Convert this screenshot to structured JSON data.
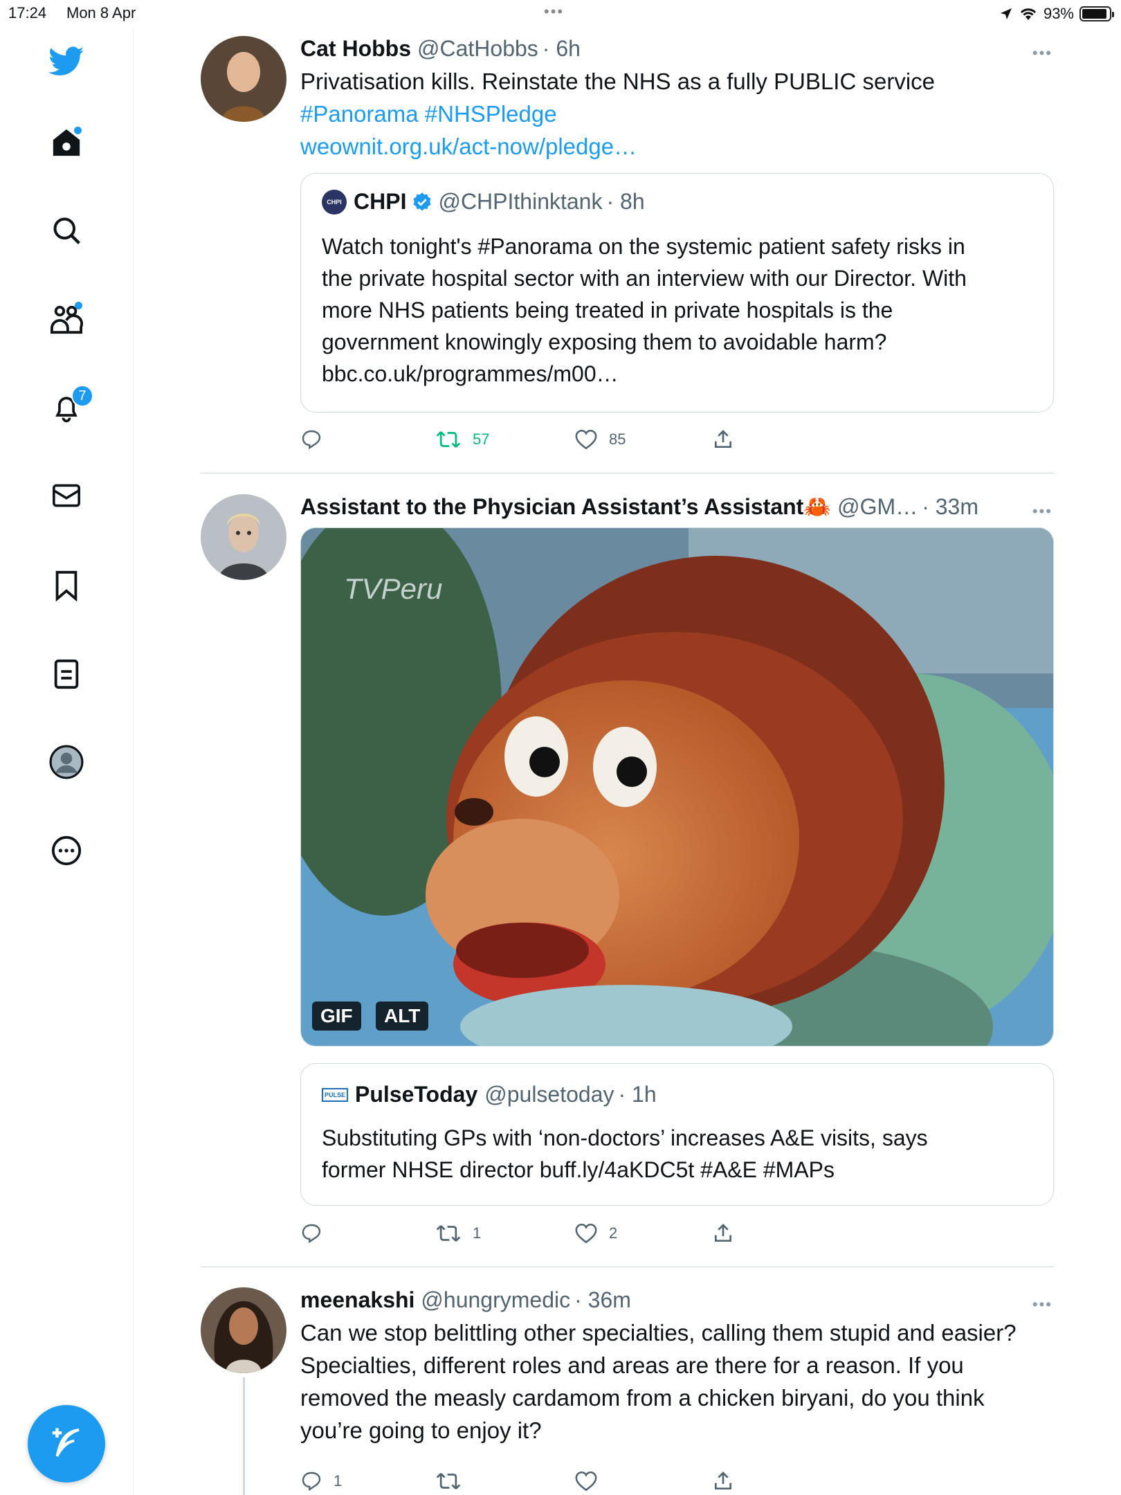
{
  "status_bar": {
    "time": "17:24",
    "date": "Mon 8 Apr",
    "battery": "93%",
    "battery_level": 0.93
  },
  "sidebar": {
    "items": [
      {
        "name": "twitter-logo"
      },
      {
        "name": "home",
        "has_dot": true
      },
      {
        "name": "explore"
      },
      {
        "name": "communities",
        "has_dot": true
      },
      {
        "name": "notifications",
        "badge": "7"
      },
      {
        "name": "messages"
      },
      {
        "name": "bookmarks"
      },
      {
        "name": "lists"
      },
      {
        "name": "profile"
      },
      {
        "name": "more"
      }
    ],
    "compose_icon": "feather-plus-icon"
  },
  "tweets": [
    {
      "name": "Cat Hobbs",
      "handle": "@CatHobbs",
      "time": "· 6h",
      "text": "Privatisation kills. Reinstate the NHS as a fully PUBLIC service",
      "hashtags": "#Panorama #NHSPledge",
      "link": "weownit.org.uk/act-now/pledge…",
      "quote": {
        "avatar_label": "CHPI",
        "name": "CHPI",
        "handle": "@CHPIthinktank",
        "time": "· 8h",
        "lines": [
          "Watch tonight's #Panorama on the systemic patient safety risks in",
          "the private hospital sector with an interview with our Director. With",
          "more NHS patients being treated in private hospitals is the",
          "government knowingly exposing them to avoidable harm?",
          "bbc.co.uk/programmes/m00…"
        ]
      },
      "actions": {
        "replies": "",
        "retweets": "57",
        "likes": "85"
      }
    },
    {
      "name": "Assistant to the Physician Assistant’s Assistant🦀",
      "handle": "@GM…",
      "time": "· 33m",
      "media": {
        "watermark": "TVPeru",
        "gif_label": "GIF",
        "alt_label": "ALT"
      },
      "quote": {
        "avatar_label": "PULSE",
        "name": "PulseToday",
        "handle": "@pulsetoday",
        "time": "· 1h",
        "lines": [
          "Substituting GPs with ‘non-doctors’ increases A&E visits, says",
          "former NHSE director buff.ly/4aKDC5t #A&E #MAPs"
        ]
      },
      "actions": {
        "replies": "",
        "retweets": "1",
        "likes": "2"
      }
    },
    {
      "name": "meenakshi",
      "handle": "@hungrymedic",
      "time": "· 36m",
      "lines": [
        "Can we stop belittling other specialties, calling them stupid and easier?",
        "Specialties, different roles and areas are there for a reason. If you",
        "removed the measly cardamom from a chicken biryani, do you think",
        "you’re going to enjoy it?"
      ],
      "actions": {
        "replies": "1",
        "retweets": "",
        "likes": ""
      }
    }
  ],
  "colors": {
    "accent": "#1d9bf0",
    "retweet": "#00ba7c",
    "muted": "#536471"
  }
}
